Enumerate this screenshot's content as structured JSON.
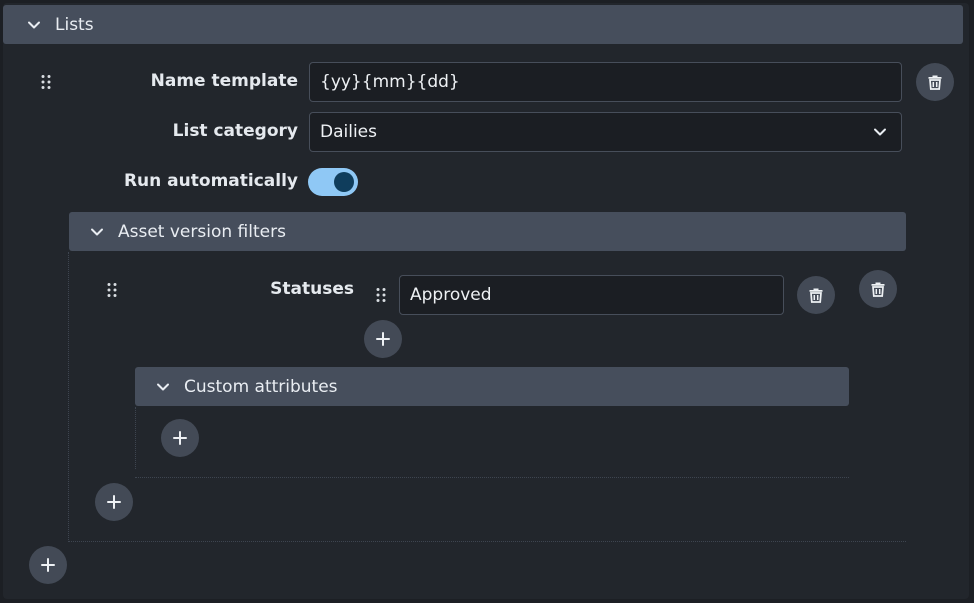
{
  "lists_section": {
    "title": "Lists",
    "name_template": {
      "label": "Name template",
      "value": "{yy}{mm}{dd}"
    },
    "list_category": {
      "label": "List category",
      "value": "Dailies"
    },
    "run_automatically": {
      "label": "Run automatically",
      "checked": true
    },
    "asset_version_filters": {
      "title": "Asset version filters",
      "statuses": {
        "label": "Statuses",
        "values": [
          "Approved"
        ]
      },
      "custom_attributes": {
        "title": "Custom attributes"
      }
    }
  },
  "icons": {
    "collapse": "chevron-down-icon",
    "delete": "trash-icon",
    "add": "plus-icon",
    "drag": "drag-handle-icon",
    "dropdown": "chevron-down-icon"
  },
  "colors": {
    "background": "#22262c",
    "header": "#464e5c",
    "input_bg": "#1b1e23",
    "button_bg": "#434a56",
    "toggle_on": "#8fc8f5"
  }
}
